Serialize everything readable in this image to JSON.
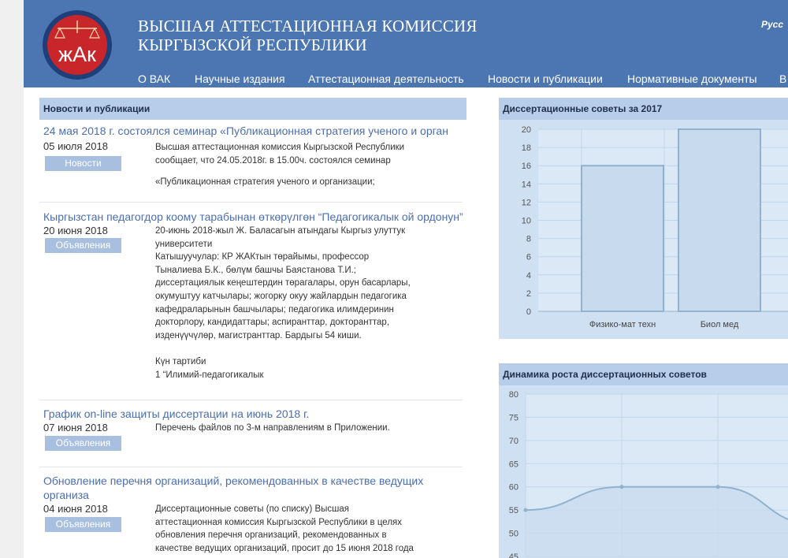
{
  "header": {
    "logo_letters": "жАк",
    "title_line1": "ВЫСШАЯ АТТЕСТАЦИОННАЯ КОМИССИЯ",
    "title_line2": "КЫРГЫЗСКОЙ РЕСПУБЛИКИ",
    "language": "Русс"
  },
  "nav": [
    "О ВАК",
    "Научные издания",
    "Аттестационная деятельность",
    "Новости и публикации",
    "Нормативные документы",
    "В"
  ],
  "news": {
    "heading": "Новости и публикации",
    "items": [
      {
        "title": "24 мая 2018 г. состоялся семинар «Публикационная стратегия ученого и орган",
        "date": "05 июля 2018",
        "tag": "Новости",
        "text": [
          "Высшая аттестационная комиссия Кыргызской Республики",
          "сообщает, что 24.05.2018г. в 15.00ч. состоялся семинар",
          "",
          "«Публикационная стратегия ученого и организации;"
        ]
      },
      {
        "title": "Кыргызстан педагогдор коому тарабынан өткөрүлгөн “Педагогикалык ой ордонун”",
        "date": "20 июня 2018",
        "tag": "Объявления",
        "text": [
          "20-июнь 2018-жыл Ж. Баласагын атындагы Кыргыз улуттук",
          "университети",
          "Катышуучулар: КР ЖАКтын төрайымы, профессор",
          "Тыналиева Б.К., бөлүм башчы Баястанова Т.И.;",
          "диссертациялык кеңештердин төрагалары, орун басарлары,",
          "окумуштуу катчылары; жогорку окуу жайлардын педагогика",
          "кафедраларынын башчылары; педагогика илимдеринин",
          "докторлору, кандидаттары; аспиранттар, докторанттар,",
          "изденүүчүлөр, магистранттар. Бардыгы 54 киши.",
          "",
          "Күн тартиби",
          "1 “Илимий-педагогикалык"
        ]
      },
      {
        "title": "График on-line защиты диссертации на июнь 2018 г.",
        "date": "07 июня 2018",
        "tag": "Объявления",
        "text": [
          "Перечень файлов по 3-м направлениям в Приложении."
        ]
      },
      {
        "title": "Обновление перечня организаций, рекомендованных в качестве ведущих организа",
        "date": "04 июня 2018",
        "tag": "Объявления",
        "text": [
          "Диссертационные советы (по списку) Высшая",
          "аттестационная комиссия Кыргызской Республики в целях",
          "обновления перечня организаций, рекомендованных в",
          "качестве ведущих организаций, просит до 15 июня 2018 года"
        ]
      }
    ]
  },
  "chart_data": [
    {
      "type": "bar",
      "title": "Диссертационные советы за 2017",
      "categories": [
        "Физико-мат техн",
        "Биол мед"
      ],
      "values": [
        16,
        20
      ],
      "ylim": [
        0,
        20
      ],
      "yticks": [
        0,
        2,
        4,
        6,
        8,
        10,
        12,
        14,
        16,
        18,
        20
      ],
      "grid": true,
      "colors": {
        "bar_fill": "#c8dbee",
        "bar_stroke": "#8fb3cf",
        "plot_bg": "#dbe8f5"
      }
    },
    {
      "type": "area",
      "title": "Динамика роста диссертационных советов",
      "x": [
        0,
        1,
        2,
        3
      ],
      "values": [
        55,
        60,
        60,
        52
      ],
      "ylim": [
        45,
        80
      ],
      "yticks": [
        45,
        50,
        55,
        60,
        65,
        70,
        75,
        80
      ],
      "grid": true,
      "colors": {
        "line": "#8fb3cf",
        "fill": "#c8dbee",
        "plot_bg": "#dbe8f5"
      }
    }
  ]
}
